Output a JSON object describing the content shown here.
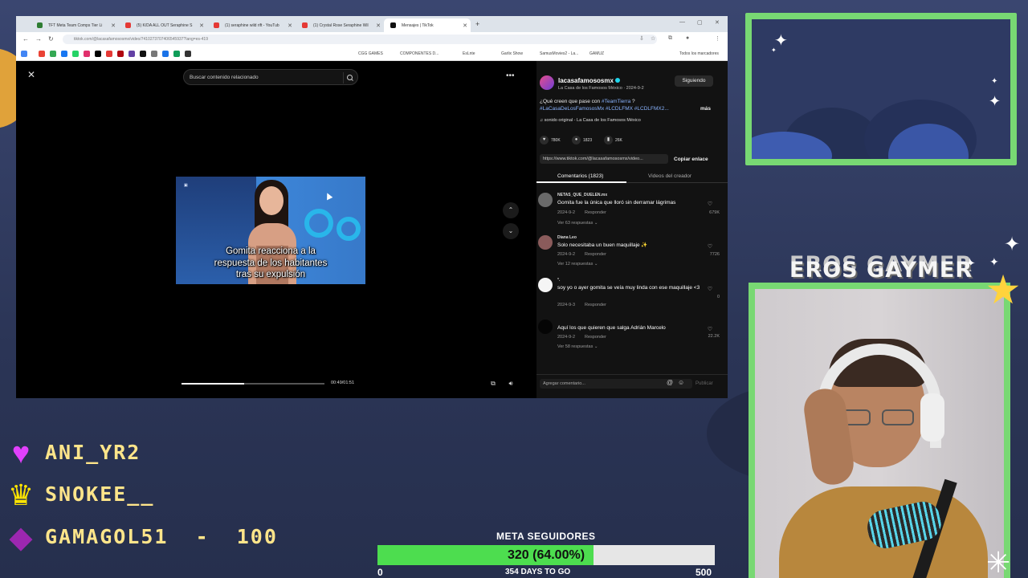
{
  "browser": {
    "tabs": [
      {
        "label": "TFT Meta Team Comps Tier Li",
        "color": "#2e7d32"
      },
      {
        "label": "(5) K/DA ALL OUT Seraphine S",
        "color": "#e53935"
      },
      {
        "label": "(1) seraphine wild rift - YouTub",
        "color": "#e53935"
      },
      {
        "label": "(1) Crystal Rose Seraphine Wil",
        "color": "#e53935"
      },
      {
        "label": "Mensajes | TikTok",
        "color": "#111111"
      }
    ],
    "url": "tiktok.com/@lacasafamososmx/video/7410273707406545937?lang=es-419",
    "bookmarks": [
      "CGG GAMES",
      "COMPONENTES D...",
      "EsLnte",
      "Garlix Show",
      "SamusMovies2 - La...",
      "GAMUZ",
      "Todos los marcadores"
    ]
  },
  "video": {
    "search_placeholder": "Buscar contenido relacionado",
    "caption_line1": "Gomita reacciona a la",
    "caption_line2": "respuesta de los habitantes",
    "caption_line3": "tras su expulsión",
    "time": "00:49/01:51",
    "progress": 0.44
  },
  "panel": {
    "username": "lacasafamososmx",
    "subtitle": "La Casa de los Famosos México · 2024-9-2",
    "follow_label": "Siguiendo",
    "desc_prefix": "¿Qué creen que pase con ",
    "desc_tag1": "#TeamTierra",
    "desc_suffix": " ?",
    "desc_tags2": "#LaCasaDeLosFamososMx #LCDLFMX #LCDLFMX2...",
    "more_label": "más",
    "sound": "♫  sonido original - La Casa de los Famosos México",
    "likes": "780K",
    "comments_count": "1823",
    "saves": "26K",
    "link": "https://www.tiktok.com/@lacasafamososmx/video...",
    "copy_label": "Copiar enlace",
    "tab_comments": "Comentarios (1823)",
    "tab_videos": "Videos del creador",
    "comments": [
      {
        "user": "NETAS_QUE_DUELEN.mx",
        "text": "Gomita fue la única que lloró sin derramar lágrimas",
        "date": "2024-9-2",
        "reply": "Responder",
        "replies": "Ver 63 respuestas ⌄",
        "likes": "679K"
      },
      {
        "user": "Diana Leo",
        "text": "Solo necesitaba un buen maquillaje ✨",
        "date": "2024-9-2",
        "reply": "Responder",
        "replies": "Ver 12 respuestas ⌄",
        "likes": "7726"
      },
      {
        "user": "°.",
        "text": "soy yo o ayer gomita se veía muy linda con ese maquillaje <3",
        "date": "2024-9-3",
        "reply": "Responder",
        "replies": "",
        "likes": "0"
      },
      {
        "user": "",
        "text": "Aquí los que quieren que salga Adrián Marcelo",
        "date": "2024-9-2",
        "reply": "Responder",
        "replies": "Ver 58 respuestas ⌄",
        "likes": "22.2K"
      }
    ],
    "add_comment_placeholder": "Agregar comentario...",
    "post_label": "Publicar"
  },
  "overlay": {
    "brand": "EROS GAYMER",
    "events": [
      {
        "icon": "heart-icon",
        "text": "ANI_YR2",
        "color": "#e040fb"
      },
      {
        "icon": "crown-icon",
        "text": "SNOKEE__",
        "color": "#ffe500"
      },
      {
        "icon": "gem-icon",
        "text": "GAMAGOL51  -  100",
        "color": "#9c27b0"
      }
    ],
    "goal": {
      "title": "META SEGUIDORES",
      "label": "320 (64.00%)",
      "current": 320,
      "target": 500,
      "percent": 64,
      "min": "0",
      "max": "500",
      "days": "354 DAYS TO GO"
    }
  }
}
